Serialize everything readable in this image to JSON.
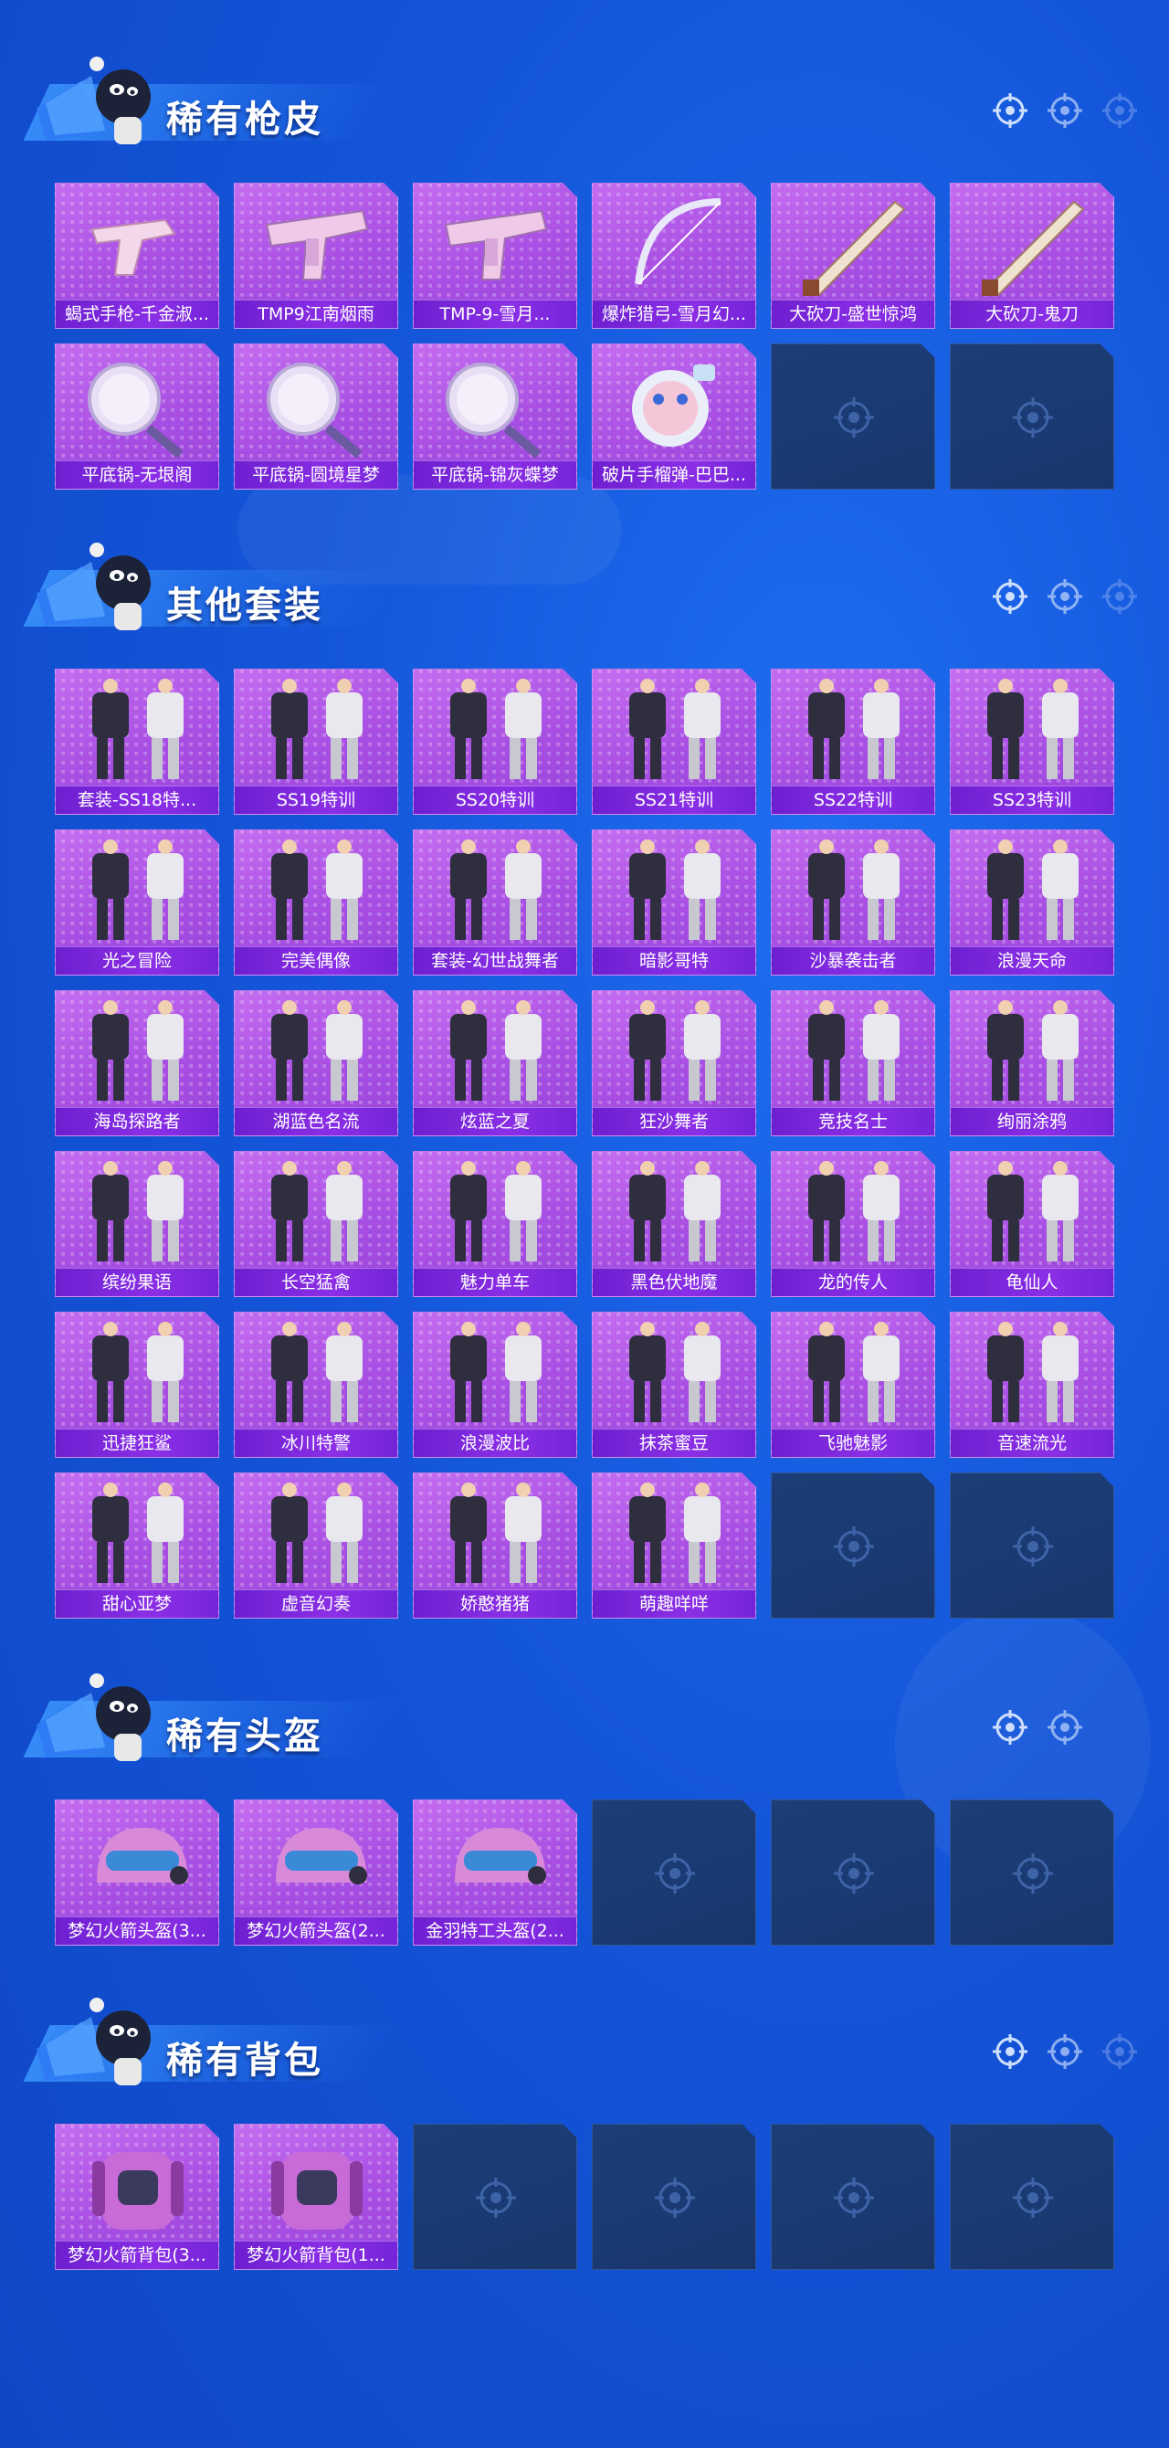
{
  "colors": {
    "background": "#1455d9",
    "card_purple": "#a84fe3",
    "label_bar": "#7424d8",
    "empty_slot": "#1a3a73"
  },
  "sections": [
    {
      "title": "稀有枪皮",
      "items": [
        {
          "label": "蝎式手枪-千金淑...",
          "icon": "pistol-icon"
        },
        {
          "label": "TMP9江南烟雨",
          "icon": "smg-icon"
        },
        {
          "label": "TMP-9-雪月...",
          "icon": "smg-icon"
        },
        {
          "label": "爆炸猎弓-雪月幻...",
          "icon": "bow-icon"
        },
        {
          "label": "大砍刀-盛世惊鸿",
          "icon": "machete-icon"
        },
        {
          "label": "大砍刀-鬼刀",
          "icon": "machete-icon"
        },
        {
          "label": "平底锅-无垠阁",
          "icon": "pan-icon"
        },
        {
          "label": "平底锅-圆境星梦",
          "icon": "pan-icon"
        },
        {
          "label": "平底锅-锦灰蝶梦",
          "icon": "pan-icon"
        },
        {
          "label": "破片手榴弹-巴巴...",
          "icon": "grenade-icon"
        }
      ],
      "empty_slots": 2
    },
    {
      "title": "其他套装",
      "items": [
        {
          "label": "套装-SS18特...",
          "icon": "outfit-icon"
        },
        {
          "label": "SS19特训",
          "icon": "outfit-icon"
        },
        {
          "label": "SS20特训",
          "icon": "outfit-icon"
        },
        {
          "label": "SS21特训",
          "icon": "outfit-icon"
        },
        {
          "label": "SS22特训",
          "icon": "outfit-icon"
        },
        {
          "label": "SS23特训",
          "icon": "outfit-icon"
        },
        {
          "label": "光之冒险",
          "icon": "outfit-icon"
        },
        {
          "label": "完美偶像",
          "icon": "outfit-icon"
        },
        {
          "label": "套装-幻世战舞者",
          "icon": "outfit-icon"
        },
        {
          "label": "暗影哥特",
          "icon": "outfit-icon"
        },
        {
          "label": "沙暴袭击者",
          "icon": "outfit-icon"
        },
        {
          "label": "浪漫天命",
          "icon": "outfit-icon"
        },
        {
          "label": "海岛探路者",
          "icon": "outfit-icon"
        },
        {
          "label": "湖蓝色名流",
          "icon": "outfit-icon"
        },
        {
          "label": "炫蓝之夏",
          "icon": "outfit-icon"
        },
        {
          "label": "狂沙舞者",
          "icon": "outfit-icon"
        },
        {
          "label": "竞技名士",
          "icon": "outfit-icon"
        },
        {
          "label": "绚丽涂鸦",
          "icon": "outfit-icon"
        },
        {
          "label": "缤纷果语",
          "icon": "outfit-icon"
        },
        {
          "label": "长空猛禽",
          "icon": "outfit-icon"
        },
        {
          "label": "魅力单车",
          "icon": "outfit-icon"
        },
        {
          "label": "黑色伏地魔",
          "icon": "outfit-icon"
        },
        {
          "label": "龙的传人",
          "icon": "outfit-icon"
        },
        {
          "label": "龟仙人",
          "icon": "outfit-icon"
        },
        {
          "label": "迅捷狂鲨",
          "icon": "outfit-icon"
        },
        {
          "label": "冰川特警",
          "icon": "outfit-icon"
        },
        {
          "label": "浪漫波比",
          "icon": "outfit-icon"
        },
        {
          "label": "抹茶蜜豆",
          "icon": "outfit-icon"
        },
        {
          "label": "飞驰魅影",
          "icon": "outfit-icon"
        },
        {
          "label": "音速流光",
          "icon": "outfit-icon"
        },
        {
          "label": "甜心亚梦",
          "icon": "outfit-icon"
        },
        {
          "label": "虚音幻奏",
          "icon": "outfit-icon"
        },
        {
          "label": "娇憨猪猪",
          "icon": "outfit-icon"
        },
        {
          "label": "萌趣咩咩",
          "icon": "outfit-icon"
        }
      ],
      "empty_slots": 2
    },
    {
      "title": "稀有头盔",
      "items": [
        {
          "label": "梦幻火箭头盔(3...",
          "icon": "helmet-icon"
        },
        {
          "label": "梦幻火箭头盔(2...",
          "icon": "helmet-icon"
        },
        {
          "label": "金羽特工头盔(2...",
          "icon": "helmet-icon"
        }
      ],
      "empty_slots": 3
    },
    {
      "title": "稀有背包",
      "items": [
        {
          "label": "梦幻火箭背包(3...",
          "icon": "backpack-icon"
        },
        {
          "label": "梦幻火箭背包(1...",
          "icon": "backpack-icon"
        }
      ],
      "empty_slots": 4
    }
  ]
}
